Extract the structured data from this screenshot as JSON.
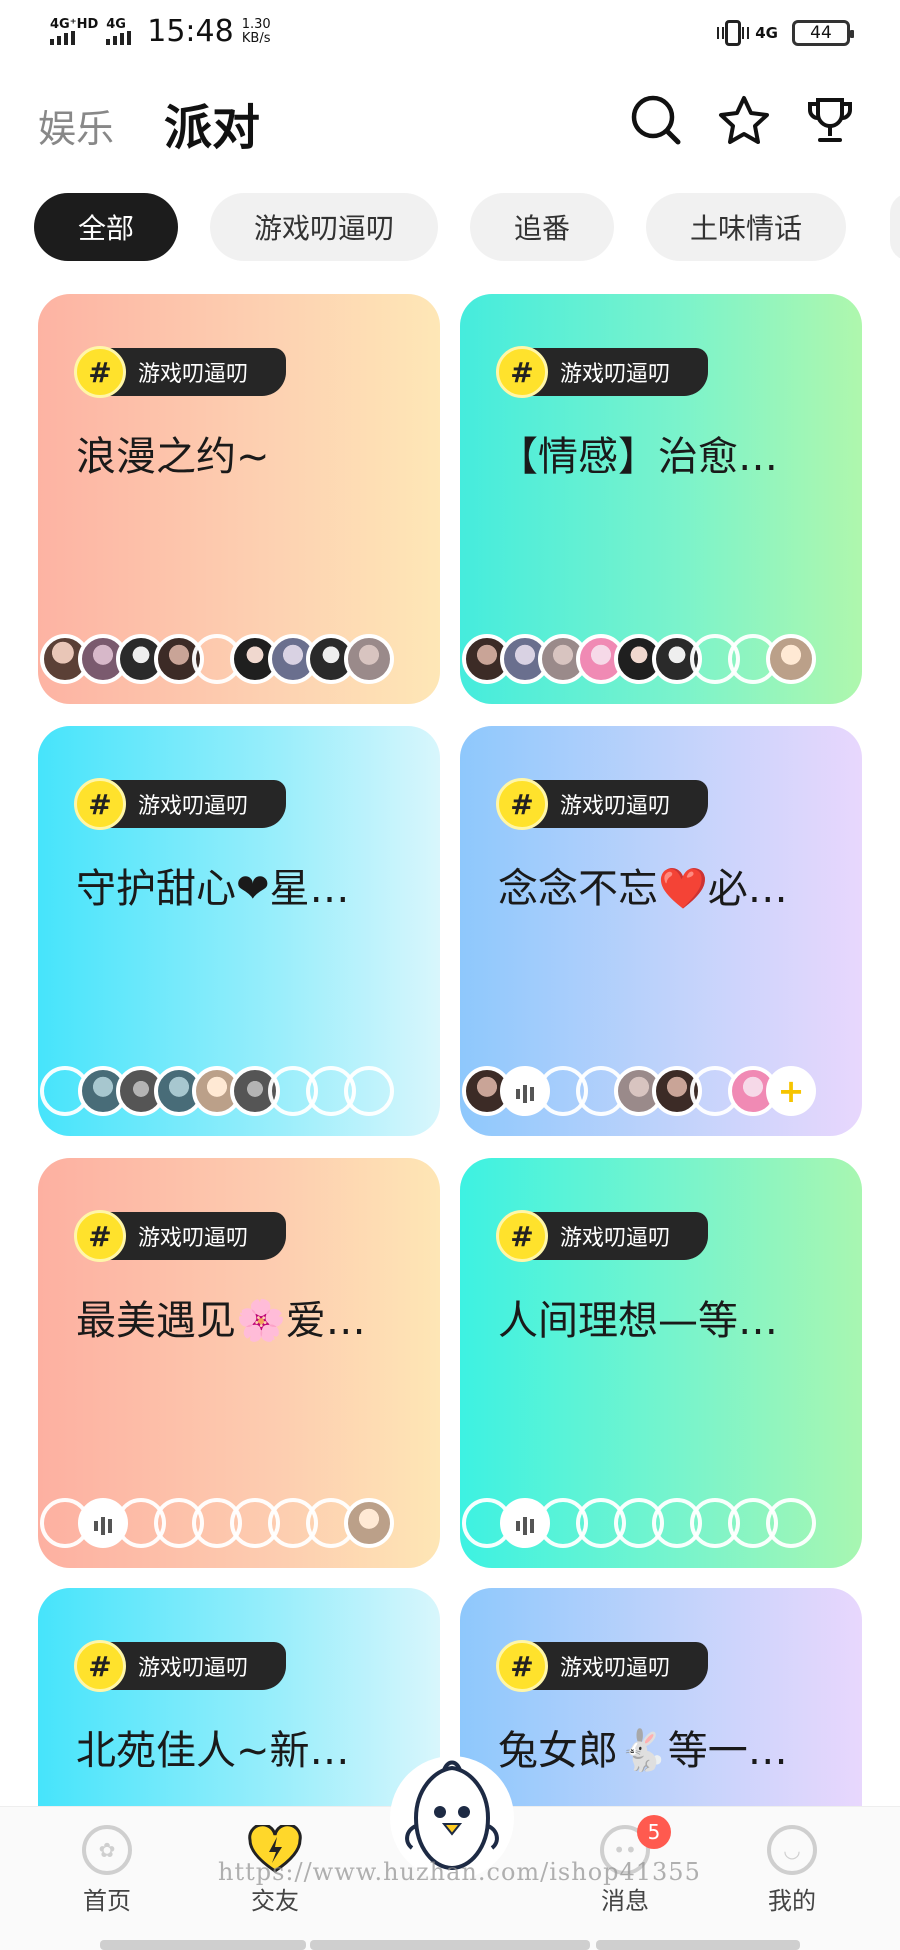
{
  "status_bar": {
    "sim1": "4G⁺HD",
    "sim2": "4G",
    "time": "15:48",
    "speed_value": "1.30",
    "speed_unit": "KB/s",
    "network": "4G",
    "battery": "44"
  },
  "header": {
    "tab_entertainment": "娱乐",
    "tab_party": "派对",
    "icons": [
      "search-icon",
      "star-icon",
      "trophy-icon"
    ]
  },
  "chips": [
    "全部",
    "游戏叨逼叨",
    "追番",
    "土味情话"
  ],
  "rooms": [
    {
      "tag": "游戏叨逼叨",
      "title": "浪漫之约~",
      "theme": "orange"
    },
    {
      "tag": "游戏叨逼叨",
      "title": "【情感】治愈…",
      "theme": "teal"
    },
    {
      "tag": "游戏叨逼叨",
      "title": "守护甜心❤星…",
      "theme": "blue"
    },
    {
      "tag": "游戏叨逼叨",
      "title": "念念不忘❤️必…",
      "theme": "purple"
    },
    {
      "tag": "游戏叨逼叨",
      "title": "最美遇见🌸爱…",
      "theme": "peach"
    },
    {
      "tag": "游戏叨逼叨",
      "title": "人间理想—等…",
      "theme": "mint"
    },
    {
      "tag": "游戏叨逼叨",
      "title": "北苑佳人~新…",
      "theme": "blue"
    },
    {
      "tag": "游戏叨逼叨",
      "title": "兔女郎🐇等一…",
      "theme": "purple"
    }
  ],
  "nav": {
    "home": "首页",
    "friends": "交友",
    "messages": "消息",
    "messages_badge": "5",
    "mine": "我的"
  },
  "watermark": "https://www.huzhan.com/ishop41355",
  "colors": {
    "accent_yellow": "#ffe22c",
    "chip_active": "#1c1c1c",
    "badge_red": "#ff5a4f"
  }
}
